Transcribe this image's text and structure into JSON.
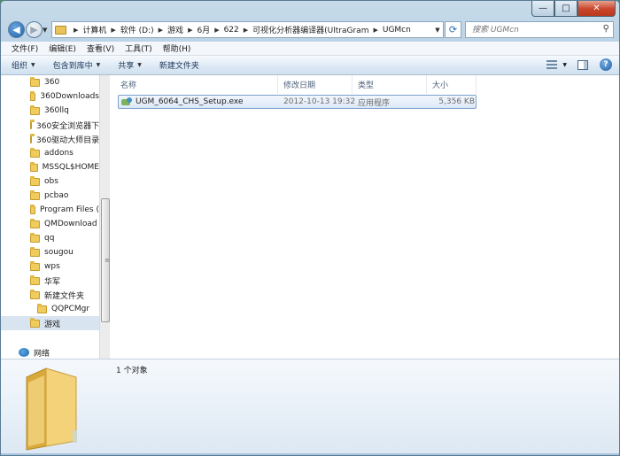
{
  "window": {
    "controls": {
      "minimize": "—",
      "maximize": "□",
      "close": "✕"
    }
  },
  "navbar": {
    "back_icon": "arrow-left-icon",
    "forward_icon": "arrow-right-icon",
    "breadcrumb": [
      "计算机",
      "软件 (D:)",
      "游戏",
      "6月",
      "622",
      "可视化分析器编译器(UltraGram",
      "UGMcn"
    ],
    "search_placeholder": "搜索 UGMcn"
  },
  "menubar": {
    "items": [
      "文件(F)",
      "编辑(E)",
      "查看(V)",
      "工具(T)",
      "帮助(H)"
    ]
  },
  "commandbar": {
    "organize": "组织",
    "include_in_library": "包含到库中",
    "share": "共享",
    "new_folder": "新建文件夹",
    "help_glyph": "?"
  },
  "navpane": {
    "items": [
      {
        "label": "360",
        "icon": "folder-icon"
      },
      {
        "label": "360Downloads",
        "icon": "folder-icon"
      },
      {
        "label": "360llq",
        "icon": "folder-icon"
      },
      {
        "label": "360安全浏览器下",
        "icon": "folder-icon"
      },
      {
        "label": "360驱动大师目录",
        "icon": "folder-icon"
      },
      {
        "label": "addons",
        "icon": "folder-icon"
      },
      {
        "label": "MSSQL$HOME",
        "icon": "folder-icon"
      },
      {
        "label": "obs",
        "icon": "folder-icon"
      },
      {
        "label": "pcbao",
        "icon": "folder-icon"
      },
      {
        "label": "Program Files (",
        "icon": "folder-icon"
      },
      {
        "label": "QMDownload",
        "icon": "folder-icon"
      },
      {
        "label": "qq",
        "icon": "folder-icon"
      },
      {
        "label": "sougou",
        "icon": "folder-icon"
      },
      {
        "label": "wps",
        "icon": "folder-icon"
      },
      {
        "label": "华军",
        "icon": "folder-icon"
      },
      {
        "label": "新建文件夹",
        "icon": "folder-icon"
      },
      {
        "label": "QQPCMgr",
        "icon": "folder-icon"
      },
      {
        "label": "游戏",
        "icon": "folder-icon",
        "selected": true
      },
      {
        "label": "网络",
        "icon": "network-icon"
      }
    ]
  },
  "content": {
    "columns": [
      "名称",
      "修改日期",
      "类型",
      "大小"
    ],
    "files": [
      {
        "name": "UGM_6064_CHS_Setup.exe",
        "modified": "2012-10-13 19:32",
        "type": "应用程序",
        "size": "5,356 KB"
      }
    ]
  },
  "details": {
    "status": "1 个对象"
  }
}
